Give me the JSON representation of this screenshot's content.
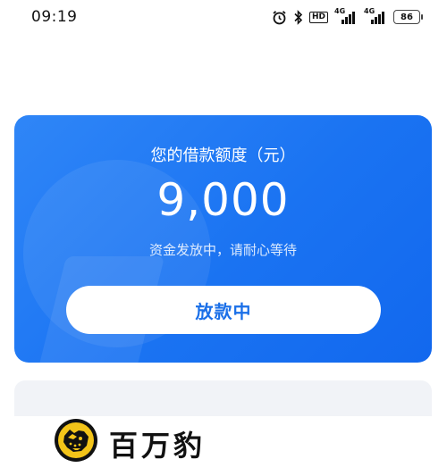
{
  "status_bar": {
    "time": "09:19",
    "hd_label": "HD",
    "network1_label": "4G",
    "network2_label": "4G",
    "battery_level": "86",
    "icons": [
      "alarm-icon",
      "bluetooth-icon",
      "hd-icon",
      "signal-4g-icon",
      "signal-4g-icon",
      "battery-icon"
    ]
  },
  "loan_card": {
    "title": "您的借款额度（元）",
    "amount": "9,000",
    "subtitle": "资金发放中，请耐心等待",
    "status_button": "放款中"
  },
  "brand": {
    "name": "百万豹",
    "logo_colors": {
      "primary": "#f3c419",
      "dark": "#111111"
    }
  },
  "colors": {
    "card_gradient_start": "#2f86f7",
    "card_gradient_end": "#1268ee",
    "button_text": "#1a6fe8",
    "lower_card": "#f1f3f7"
  }
}
